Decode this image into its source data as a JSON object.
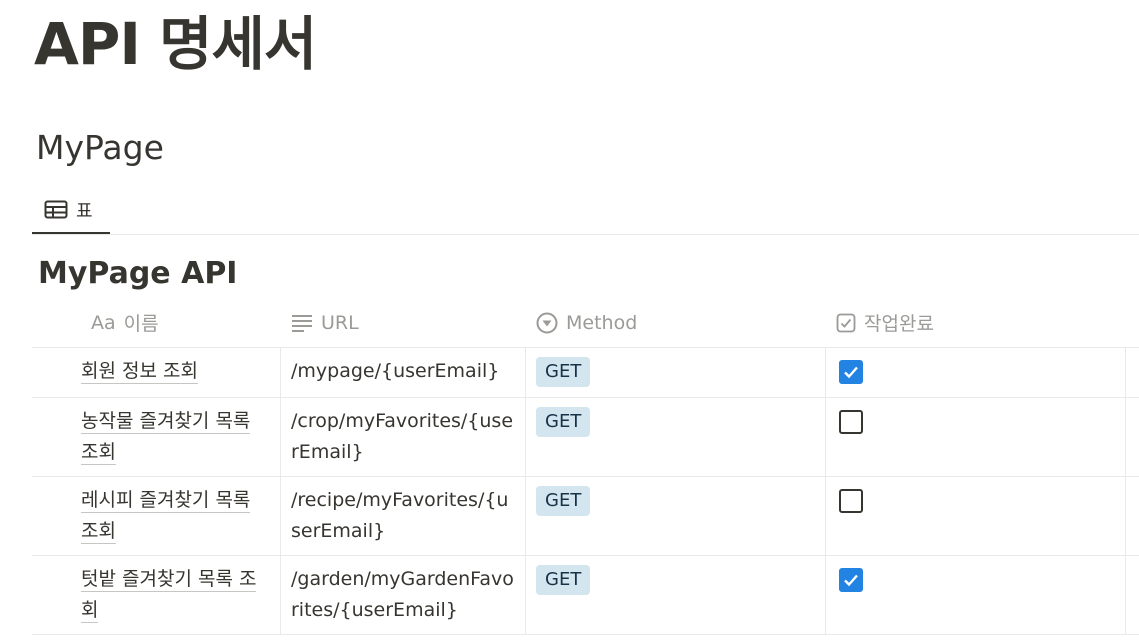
{
  "page": {
    "title": "API 명세서"
  },
  "section": {
    "title": "MyPage"
  },
  "view_tab": {
    "label": "표",
    "icon": "table-icon"
  },
  "database": {
    "title": "MyPage API"
  },
  "columns": {
    "name": {
      "label": "이름",
      "icon_text": "Aa"
    },
    "url": {
      "label": "URL",
      "icon": "text-lines-icon"
    },
    "method": {
      "label": "Method",
      "icon": "select-icon"
    },
    "done": {
      "label": "작업완료",
      "icon": "checkbox-icon"
    }
  },
  "rows": [
    {
      "name": "회원 정보 조회",
      "url": "/mypage/{userEmail}",
      "method": "GET",
      "done": true
    },
    {
      "name": "농작물 즐겨찾기 목록 조회",
      "url": "/crop/myFavorites/{userEmail}",
      "method": "GET",
      "done": false
    },
    {
      "name": "레시피 즐겨찾기 목록 조회",
      "url": "/recipe/myFavorites/{userEmail}",
      "method": "GET",
      "done": false
    },
    {
      "name": "텃밭 즐겨찾기 목록 조회",
      "url": "/garden/myGardenFavorites/{userEmail}",
      "method": "GET",
      "done": true
    }
  ],
  "colors": {
    "text": "#37352f",
    "muted": "#9b9a97",
    "checked": "#2383e2",
    "tag_bg": "#d3e5ef",
    "tag_text": "#183347",
    "border": "#e9e9e7"
  }
}
